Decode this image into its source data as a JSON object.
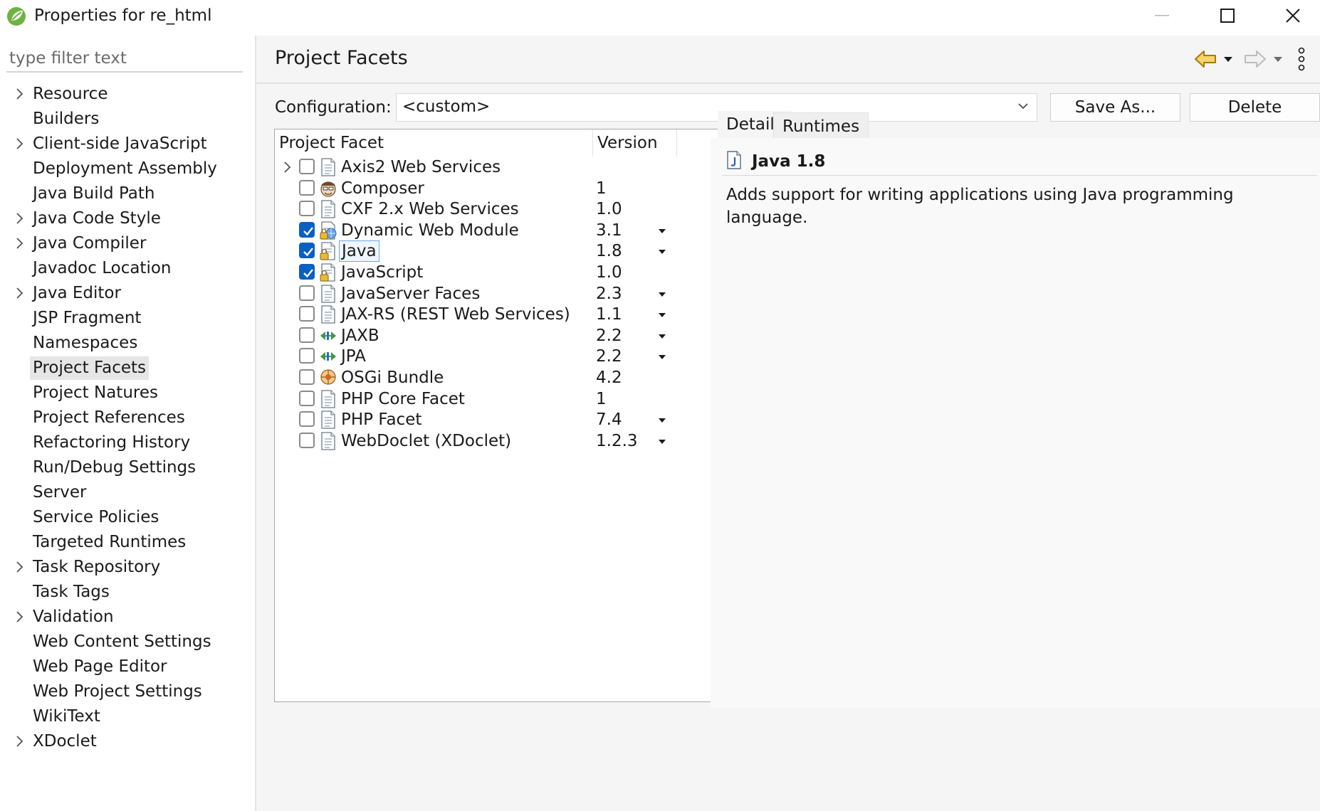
{
  "window": {
    "title": "Properties for re_html"
  },
  "filter": {
    "placeholder": "type filter text"
  },
  "sidebar": {
    "items": [
      {
        "label": "Resource",
        "expandable": true
      },
      {
        "label": "Builders",
        "expandable": false
      },
      {
        "label": "Client-side JavaScript",
        "expandable": true
      },
      {
        "label": "Deployment Assembly",
        "expandable": false
      },
      {
        "label": "Java Build Path",
        "expandable": false
      },
      {
        "label": "Java Code Style",
        "expandable": true
      },
      {
        "label": "Java Compiler",
        "expandable": true
      },
      {
        "label": "Javadoc Location",
        "expandable": false
      },
      {
        "label": "Java Editor",
        "expandable": true
      },
      {
        "label": "JSP Fragment",
        "expandable": false
      },
      {
        "label": "Namespaces",
        "expandable": false
      },
      {
        "label": "Project Facets",
        "expandable": false,
        "selected": true
      },
      {
        "label": "Project Natures",
        "expandable": false
      },
      {
        "label": "Project References",
        "expandable": false
      },
      {
        "label": "Refactoring History",
        "expandable": false
      },
      {
        "label": "Run/Debug Settings",
        "expandable": false
      },
      {
        "label": "Server",
        "expandable": false
      },
      {
        "label": "Service Policies",
        "expandable": false
      },
      {
        "label": "Targeted Runtimes",
        "expandable": false
      },
      {
        "label": "Task Repository",
        "expandable": true
      },
      {
        "label": "Task Tags",
        "expandable": false
      },
      {
        "label": "Validation",
        "expandable": true
      },
      {
        "label": "Web Content Settings",
        "expandable": false
      },
      {
        "label": "Web Page Editor",
        "expandable": false
      },
      {
        "label": "Web Project Settings",
        "expandable": false
      },
      {
        "label": "WikiText",
        "expandable": false
      },
      {
        "label": "XDoclet",
        "expandable": true
      }
    ]
  },
  "page": {
    "title": "Project Facets"
  },
  "configuration": {
    "label": "Configuration:",
    "value": "<custom>",
    "save_as_label": "Save As...",
    "delete_label": "Delete"
  },
  "facet_table": {
    "headers": {
      "facet": "Project Facet",
      "version": "Version"
    },
    "rows": [
      {
        "name": "Axis2 Web Services",
        "version": "",
        "checked": false,
        "expandable": true,
        "has_dropdown": false,
        "icon": "document-icon"
      },
      {
        "name": "Composer",
        "version": "1",
        "checked": false,
        "expandable": false,
        "has_dropdown": false,
        "icon": "composer-icon"
      },
      {
        "name": "CXF 2.x Web Services",
        "version": "1.0",
        "checked": false,
        "expandable": false,
        "has_dropdown": false,
        "icon": "document-icon"
      },
      {
        "name": "Dynamic Web Module",
        "version": "3.1",
        "checked": true,
        "expandable": false,
        "has_dropdown": true,
        "icon": "web-module-icon"
      },
      {
        "name": "Java",
        "version": "1.8",
        "checked": true,
        "expandable": false,
        "has_dropdown": true,
        "icon": "locked-document-icon",
        "focused": true
      },
      {
        "name": "JavaScript",
        "version": "1.0",
        "checked": true,
        "expandable": false,
        "has_dropdown": false,
        "icon": "locked-document-icon"
      },
      {
        "name": "JavaServer Faces",
        "version": "2.3",
        "checked": false,
        "expandable": false,
        "has_dropdown": true,
        "icon": "document-icon"
      },
      {
        "name": "JAX-RS (REST Web Services)",
        "version": "1.1",
        "checked": false,
        "expandable": false,
        "has_dropdown": true,
        "icon": "document-icon"
      },
      {
        "name": "JAXB",
        "version": "2.2",
        "checked": false,
        "expandable": false,
        "has_dropdown": true,
        "icon": "binding-arrows-icon"
      },
      {
        "name": "JPA",
        "version": "2.2",
        "checked": false,
        "expandable": false,
        "has_dropdown": true,
        "icon": "binding-arrows-icon"
      },
      {
        "name": "OSGi Bundle",
        "version": "4.2",
        "checked": false,
        "expandable": false,
        "has_dropdown": false,
        "icon": "bundle-icon"
      },
      {
        "name": "PHP Core Facet",
        "version": "1",
        "checked": false,
        "expandable": false,
        "has_dropdown": false,
        "icon": "document-icon"
      },
      {
        "name": "PHP Facet",
        "version": "7.4",
        "checked": false,
        "expandable": false,
        "has_dropdown": true,
        "icon": "document-icon"
      },
      {
        "name": "WebDoclet (XDoclet)",
        "version": "1.2.3",
        "checked": false,
        "expandable": false,
        "has_dropdown": true,
        "icon": "document-icon"
      }
    ]
  },
  "details": {
    "tabs": [
      "Details",
      "Runtimes"
    ],
    "active_tab": "Details",
    "facet_title": "Java 1.8",
    "description": "Adds support for writing applications using Java programming language."
  },
  "colors": {
    "checkbox_checked": "#0a5fc2",
    "selection_bg": "#e6e6e6",
    "focus_border": "#6aa7e6",
    "panel_bg": "#f5f5f5"
  }
}
